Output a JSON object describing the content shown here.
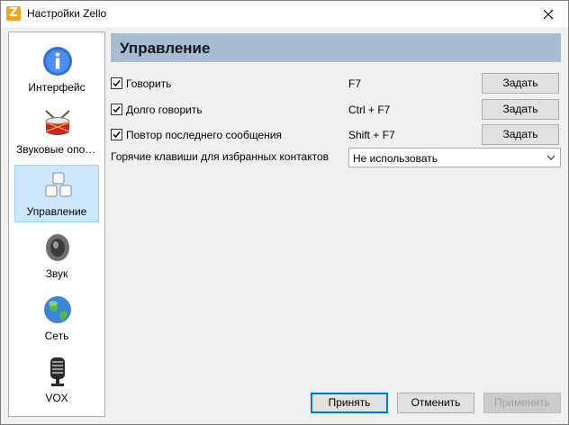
{
  "window": {
    "title": "Настройки Zello",
    "app_icon_letter": "Z"
  },
  "sidebar": {
    "items": [
      {
        "label": "Интерфейс",
        "icon": "info-icon",
        "selected": false
      },
      {
        "label": "Звуковые оповещения",
        "icon": "drum-icon",
        "selected": false
      },
      {
        "label": "Управление",
        "icon": "keys-icon",
        "selected": true
      },
      {
        "label": "Звук",
        "icon": "speaker-icon",
        "selected": false
      },
      {
        "label": "Сеть",
        "icon": "globe-icon",
        "selected": false
      },
      {
        "label": "VOX",
        "icon": "microphone-icon",
        "selected": false
      }
    ]
  },
  "main": {
    "header": "Управление",
    "hotkeys": [
      {
        "label": "Говорить",
        "checked": true,
        "key": "F7",
        "button": "Задать"
      },
      {
        "label": "Долго говорить",
        "checked": true,
        "key": "Ctrl + F7",
        "button": "Задать"
      },
      {
        "label": "Повтор последнего сообщения",
        "checked": true,
        "key": "Shift + F7",
        "button": "Задать"
      }
    ],
    "favorites": {
      "label": "Горячие клавиши для избранных контактов",
      "value": "Не использовать"
    }
  },
  "footer": {
    "accept": "Принять",
    "cancel": "Отменить",
    "apply": "Применить"
  },
  "colors": {
    "header_bg": "#a7bbd2",
    "selected_bg": "#cce8ff",
    "accent": "#0078d7"
  }
}
